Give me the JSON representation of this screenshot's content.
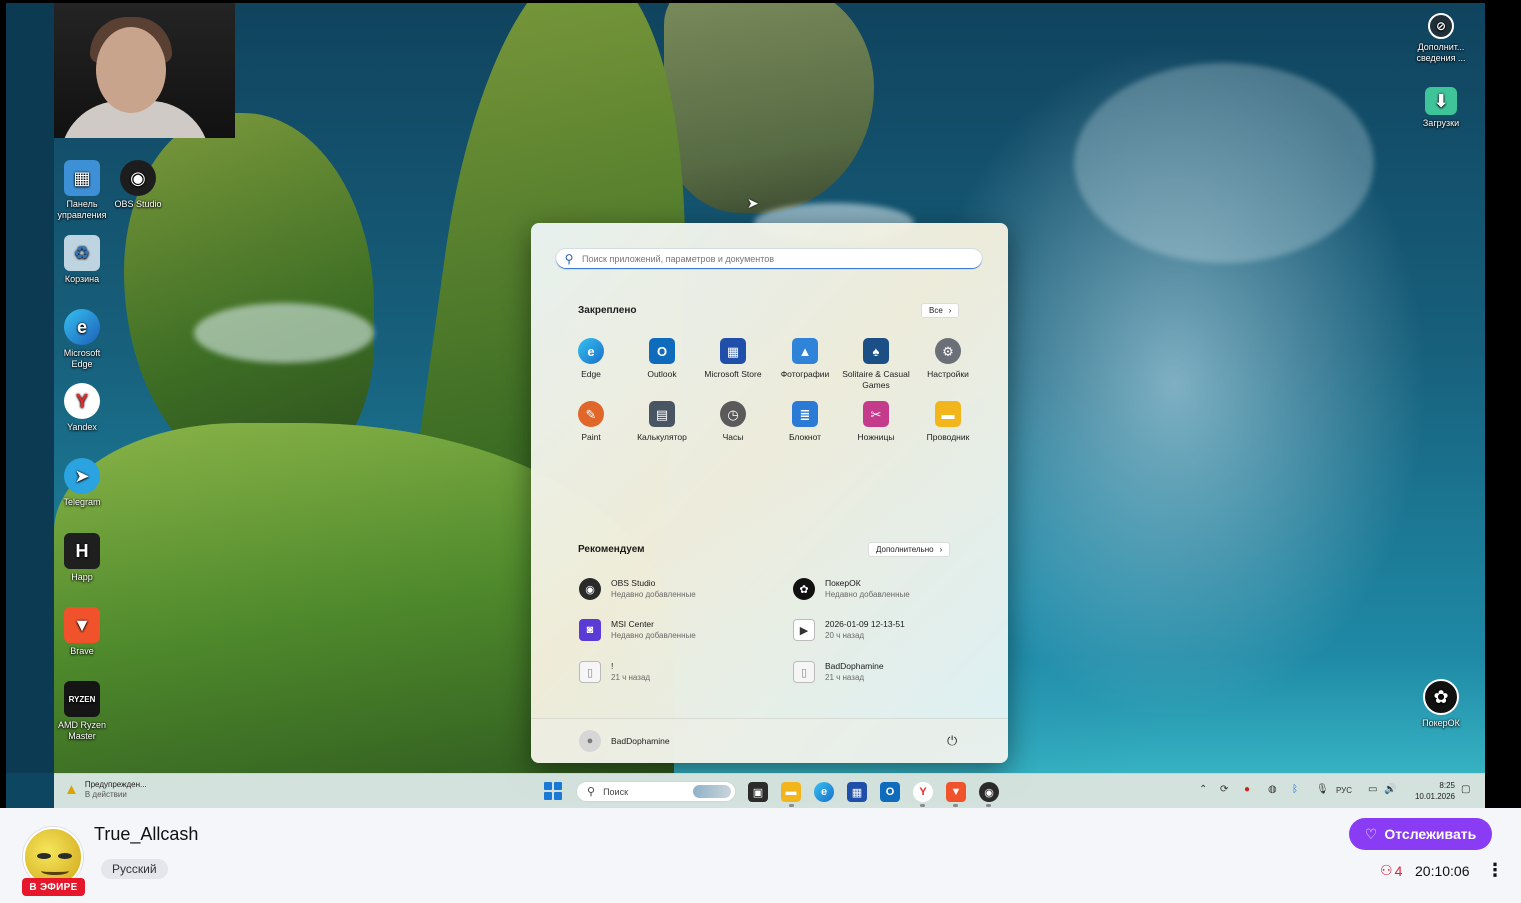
{
  "desktop": {
    "left_icons": [
      {
        "label": "Панель управления",
        "icon": "control-panel-icon"
      },
      {
        "label": "OBS Studio",
        "icon": "obs-icon"
      },
      {
        "label": "Корзина",
        "icon": "recycle-bin-icon"
      },
      {
        "label": "Microsoft Edge",
        "icon": "edge-icon"
      },
      {
        "label": "Yandex",
        "icon": "yandex-icon"
      },
      {
        "label": "Telegram",
        "icon": "telegram-icon"
      },
      {
        "label": "Happ",
        "icon": "happ-icon"
      },
      {
        "label": "Brave",
        "icon": "brave-icon"
      },
      {
        "label": "AMD Ryzen Master",
        "icon": "ryzen-icon"
      }
    ],
    "right_icons": [
      {
        "label": "Дополнит... сведения ...",
        "icon": "info-icon"
      },
      {
        "label": "Загрузки",
        "icon": "downloads-folder-icon"
      },
      {
        "label": "ПокерОК",
        "icon": "pokerok-icon"
      }
    ]
  },
  "start_menu": {
    "search_placeholder": "Поиск приложений, параметров и документов",
    "pinned_title": "Закреплено",
    "all_button": "Все",
    "pinned": [
      {
        "label": "Edge",
        "icon": "edge-icon",
        "color": "#1a8fd8"
      },
      {
        "label": "Outlook",
        "icon": "outlook-icon",
        "color": "#0f6cbd"
      },
      {
        "label": "Microsoft Store",
        "icon": "store-icon",
        "color": "#1f4fa8"
      },
      {
        "label": "Фотографии",
        "icon": "photos-icon",
        "color": "#2f83d8"
      },
      {
        "label": "Solitaire & Casual Games",
        "icon": "solitaire-icon",
        "color": "#1b4f86"
      },
      {
        "label": "Настройки",
        "icon": "settings-icon",
        "color": "#6a6f78"
      },
      {
        "label": "Paint",
        "icon": "paint-icon",
        "color": "#e0662a"
      },
      {
        "label": "Калькулятор",
        "icon": "calculator-icon",
        "color": "#4a5563"
      },
      {
        "label": "Часы",
        "icon": "clock-icon",
        "color": "#5a5a5a"
      },
      {
        "label": "Блокнот",
        "icon": "notepad-icon",
        "color": "#2b7bd6"
      },
      {
        "label": "Ножницы",
        "icon": "snipping-icon",
        "color": "#c43b8c"
      },
      {
        "label": "Проводник",
        "icon": "explorer-icon",
        "color": "#f2b51c"
      }
    ],
    "recommended_title": "Рекомендуем",
    "more_button": "Дополнительно",
    "recommended": [
      {
        "name": "OBS Studio",
        "sub": "Недавно добавленные",
        "icon": "obs-icon",
        "color": "#2a2a2a"
      },
      {
        "name": "ПокерОК",
        "sub": "Недавно добавленные",
        "icon": "pokerok-icon",
        "color": "#111111"
      },
      {
        "name": "MSI Center",
        "sub": "Недавно добавленные",
        "icon": "msi-icon",
        "color": "#5b3bd6"
      },
      {
        "name": "2026-01-09 12-13-51",
        "sub": "20 ч назад",
        "icon": "video-file-icon",
        "color": "#3a3a3a"
      },
      {
        "name": "!",
        "sub": "21 ч назад",
        "icon": "file-icon",
        "color": "#9a9a9a"
      },
      {
        "name": "BadDophamine",
        "sub": "21 ч назад",
        "icon": "file-icon",
        "color": "#9a9a9a"
      }
    ],
    "user_name": "BadDophamine"
  },
  "taskbar": {
    "notification_title": "Предупрежден...",
    "notification_sub": "В действии",
    "search_label": "Поиск",
    "lang": "РУС",
    "time": "8:25",
    "date": "10.01.2026"
  },
  "channel": {
    "name": "True_Allcash",
    "live_badge": "В ЭФИРЕ",
    "language": "Русский",
    "follow_label": "Отслеживать",
    "viewers": "4",
    "elapsed": "20:10:06"
  }
}
